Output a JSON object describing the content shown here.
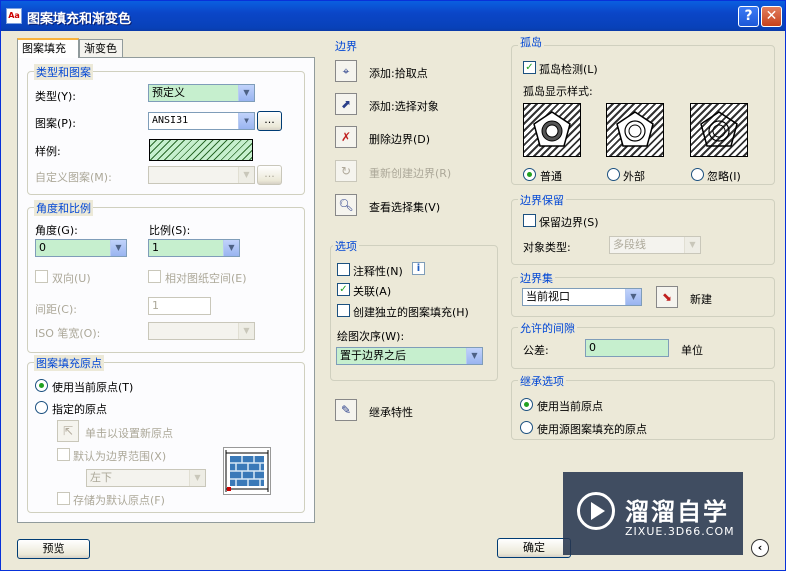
{
  "window": {
    "title": "图案填充和渐变色",
    "help": "?",
    "close": "✕",
    "icon": "Aa"
  },
  "tabs": {
    "hatch": "图案填充",
    "gradient": "渐变色"
  },
  "type_pattern": {
    "title": "类型和图案",
    "type_label": "类型(Y):",
    "type_value": "预定义",
    "pattern_label": "图案(P):",
    "pattern_value": "ANSI31",
    "browse": "...",
    "sample_label": "样例:",
    "custom_label": "自定义图案(M):",
    "custom_browse": "..."
  },
  "angle_scale": {
    "title": "角度和比例",
    "angle_label": "角度(G):",
    "angle_value": "0",
    "scale_label": "比例(S):",
    "scale_value": "1",
    "double_label": "双向(U)",
    "relative_label": "相对图纸空间(E)",
    "spacing_label": "间距(C):",
    "spacing_value": "1",
    "iso_label": "ISO 笔宽(O):"
  },
  "origin": {
    "title": "图案填充原点",
    "use_current": "使用当前原点(T)",
    "specified": "指定的原点",
    "click_set": "单击以设置新原点",
    "default_boundary": "默认为边界范围(X)",
    "position_value": "左下",
    "store_default": "存储为默认原点(F)"
  },
  "boundary": {
    "title": "边界",
    "add_pick": "添加:拾取点",
    "add_select": "添加:选择对象",
    "remove": "删除边界(D)",
    "recreate": "重新创建边界(R)",
    "view": "查看选择集(V)"
  },
  "options": {
    "title": "选项",
    "annotative": "注释性(N)",
    "associative": "关联(A)",
    "separate": "创建独立的图案填充(H)",
    "draw_order_label": "绘图次序(W):",
    "draw_order_value": "置于边界之后",
    "info_icon": "i"
  },
  "inherit": {
    "label": "继承特性"
  },
  "islands": {
    "title": "孤岛",
    "detect": "孤岛检测(L)",
    "style_label": "孤岛显示样式:",
    "normal": "普通",
    "outer": "外部",
    "ignore": "忽略(I)"
  },
  "retain": {
    "title": "边界保留",
    "retain_label": "保留边界(S)",
    "object_type_label": "对象类型:",
    "object_type_value": "多段线"
  },
  "boundary_set": {
    "title": "边界集",
    "value": "当前视口",
    "new_label": "新建"
  },
  "gap": {
    "title": "允许的间隙",
    "tolerance_label": "公差:",
    "tolerance_value": "0",
    "unit": "单位"
  },
  "inherit_options": {
    "title": "继承选项",
    "use_current": "使用当前原点",
    "use_source": "使用源图案填充的原点"
  },
  "footer": {
    "preview": "预览",
    "ok": "确定",
    "expand": "‹"
  },
  "watermark": {
    "brand": "溜溜自学",
    "url": "ZIXUE.3D66.COM"
  }
}
